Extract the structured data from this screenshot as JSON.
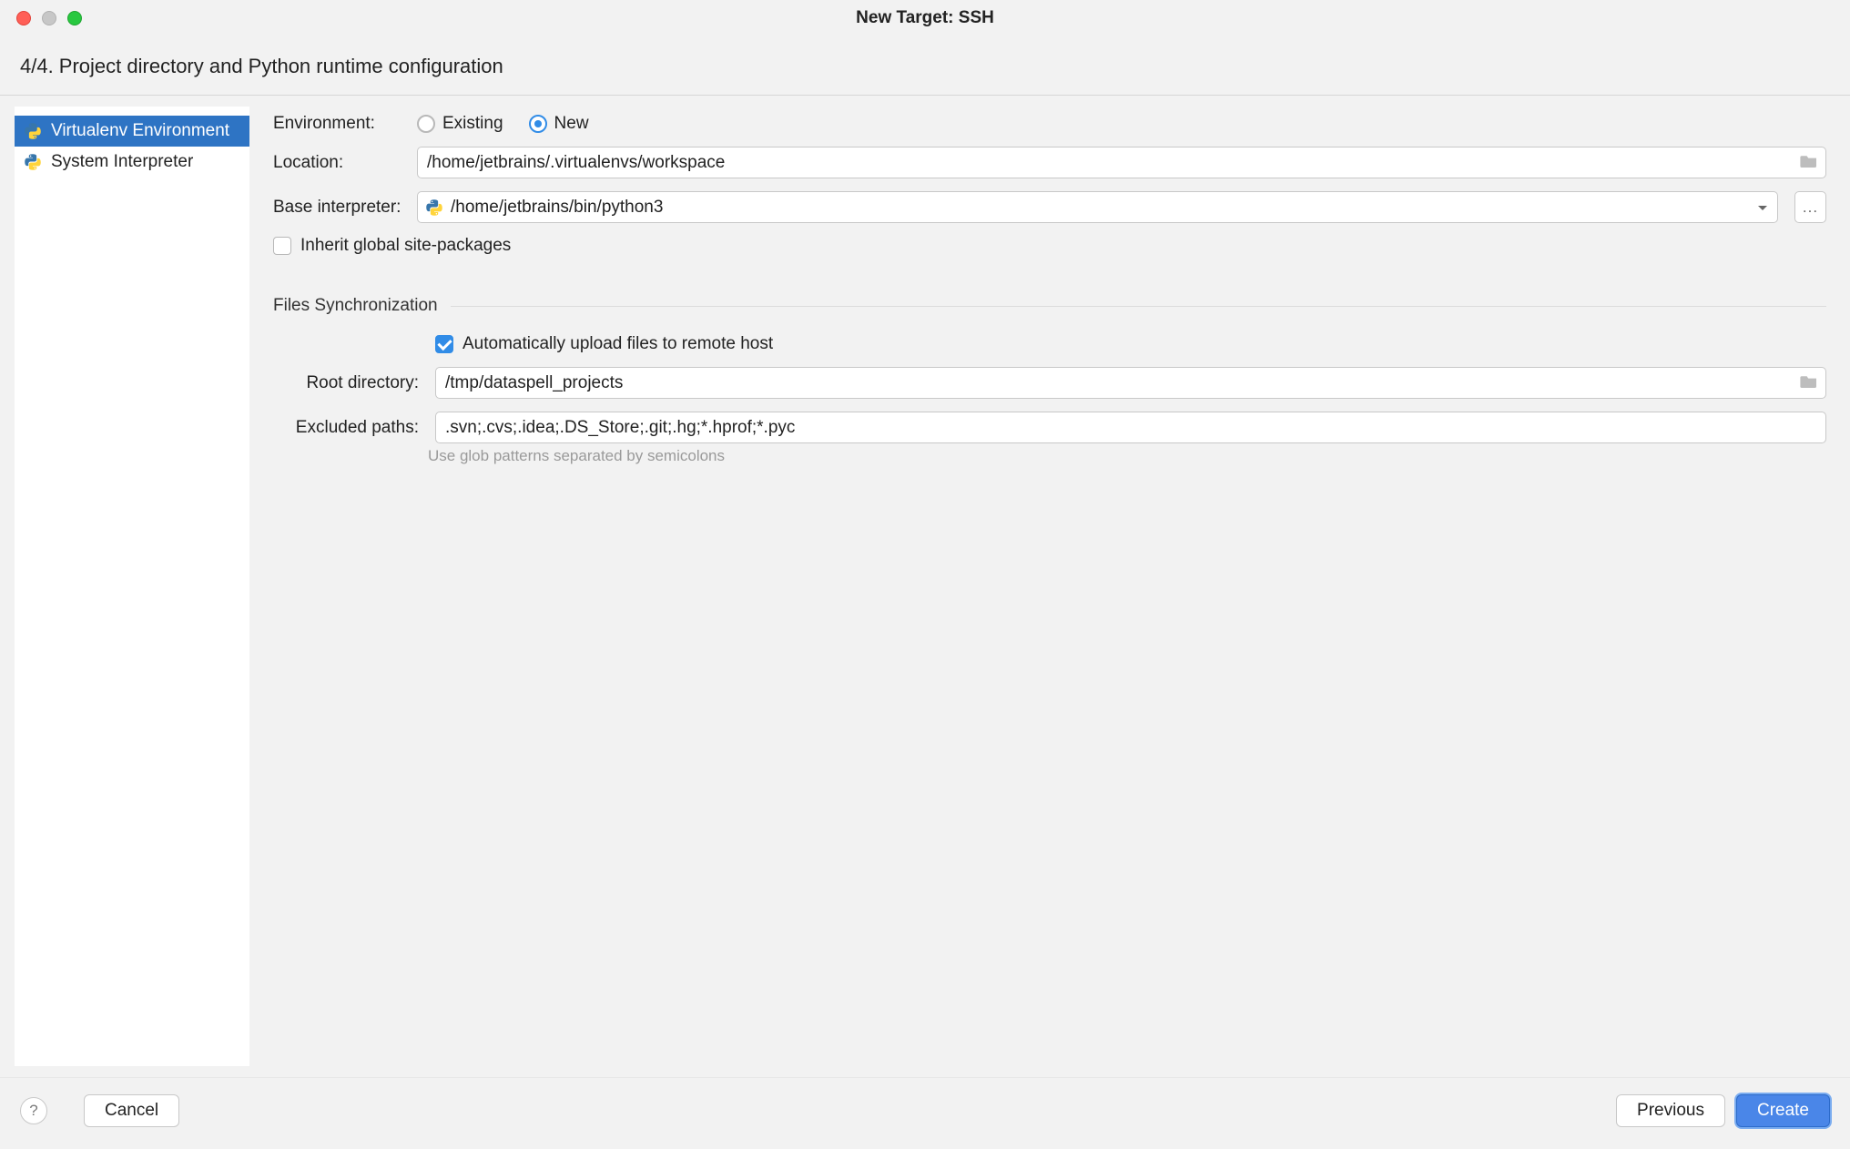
{
  "window": {
    "title": "New Target: SSH"
  },
  "step": {
    "label": "4/4. Project directory and Python runtime configuration"
  },
  "sidebar": {
    "items": [
      {
        "label": "Virtualenv Environment",
        "selected": true
      },
      {
        "label": "System Interpreter",
        "selected": false
      }
    ]
  },
  "form": {
    "environment": {
      "label": "Environment:",
      "options": {
        "existing": "Existing",
        "new": "New"
      },
      "value": "new"
    },
    "location": {
      "label": "Location:",
      "value": "/home/jetbrains/.virtualenvs/workspace"
    },
    "base_interpreter": {
      "label": "Base interpreter:",
      "value": "/home/jetbrains/bin/python3",
      "ellipsis": "..."
    },
    "inherit": {
      "label": "Inherit global site-packages",
      "checked": false
    }
  },
  "sync": {
    "section_title": "Files Synchronization",
    "auto_upload": {
      "label": "Automatically upload files to remote host",
      "checked": true
    },
    "root_directory": {
      "label": "Root directory:",
      "value": "/tmp/dataspell_projects"
    },
    "excluded_paths": {
      "label": "Excluded paths:",
      "value": ".svn;.cvs;.idea;.DS_Store;.git;.hg;*.hprof;*.pyc",
      "hint": "Use glob patterns separated by semicolons"
    }
  },
  "footer": {
    "help": "?",
    "cancel": "Cancel",
    "previous": "Previous",
    "create": "Create"
  }
}
